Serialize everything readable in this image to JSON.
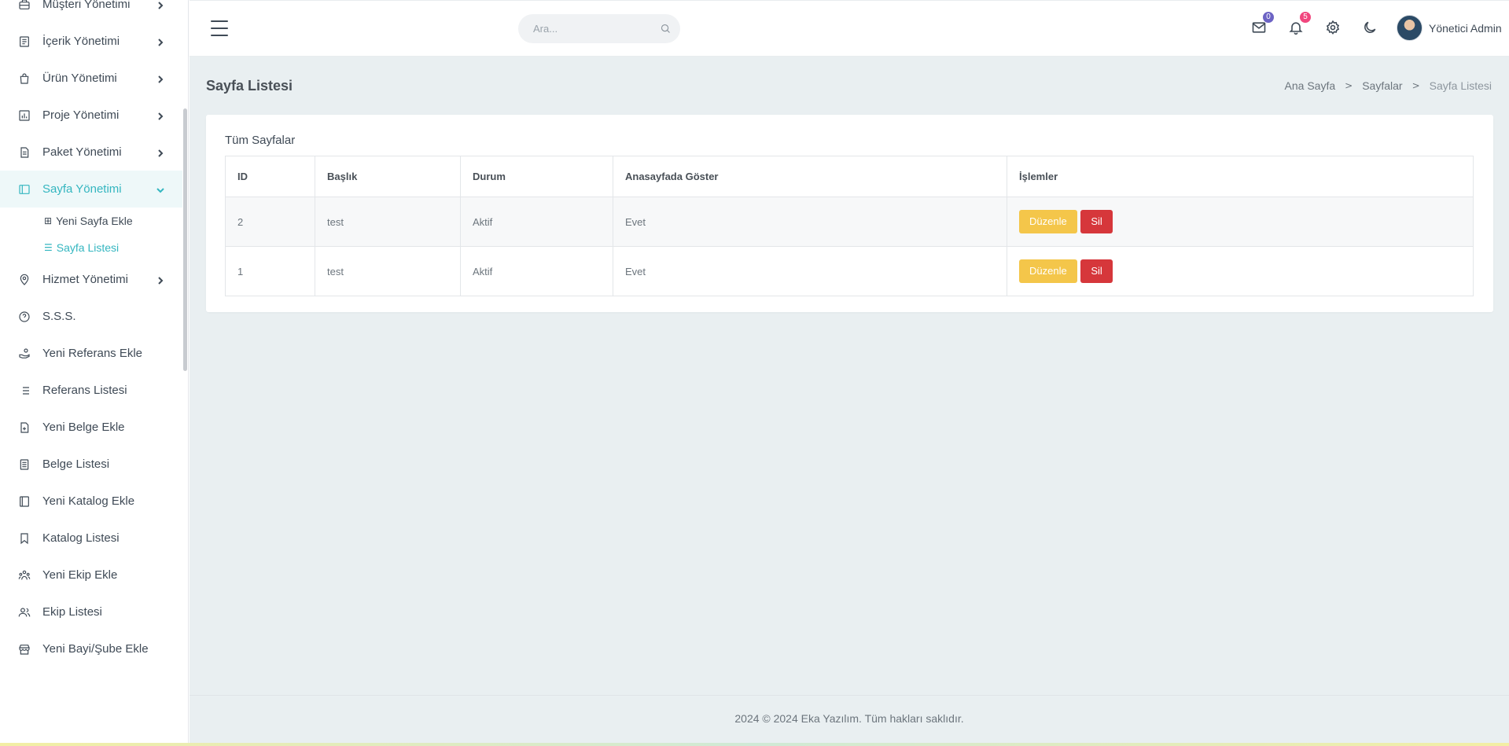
{
  "sidebar": {
    "items": [
      {
        "label": "Müşteri Yönetimi",
        "icon": "briefcase-icon",
        "has_children": true
      },
      {
        "label": "İçerik Yönetimi",
        "icon": "document-icon",
        "has_children": true
      },
      {
        "label": "Ürün Yönetimi",
        "icon": "shopping-bag-icon",
        "has_children": true
      },
      {
        "label": "Proje Yönetimi",
        "icon": "bar-chart-icon",
        "has_children": true
      },
      {
        "label": "Paket Yönetimi",
        "icon": "file-text-icon",
        "has_children": true
      },
      {
        "label": "Sayfa Yönetimi",
        "icon": "layout-icon",
        "has_children": true,
        "expanded": true
      },
      {
        "label": "Hizmet Yönetimi",
        "icon": "map-pin-icon",
        "has_children": true
      },
      {
        "label": "S.S.S.",
        "icon": "help-circle-icon"
      },
      {
        "label": "Yeni Referans Ekle",
        "icon": "hand-coins-icon"
      },
      {
        "label": "Referans Listesi",
        "icon": "list-icon"
      },
      {
        "label": "Yeni Belge Ekle",
        "icon": "file-plus-icon"
      },
      {
        "label": "Belge Listesi",
        "icon": "file-list-icon"
      },
      {
        "label": "Yeni Katalog Ekle",
        "icon": "book-open-icon"
      },
      {
        "label": "Katalog Listesi",
        "icon": "bookmark-icon"
      },
      {
        "label": "Yeni Ekip Ekle",
        "icon": "team-icon"
      },
      {
        "label": "Ekip Listesi",
        "icon": "users-icon"
      },
      {
        "label": "Yeni Bayi/Şube Ekle",
        "icon": "store-icon"
      }
    ],
    "sub_items": [
      {
        "label": "Yeni Sayfa Ekle",
        "icon_glyph": "⊞"
      },
      {
        "label": "Sayfa Listesi",
        "icon_glyph": "☰"
      }
    ]
  },
  "header": {
    "search_placeholder": "Ara...",
    "mail_badge": "0",
    "notification_badge": "5",
    "user_name": "Yönetici Admin"
  },
  "page": {
    "title": "Sayfa Listesi",
    "breadcrumb": [
      "Ana Sayfa",
      "Sayfalar",
      "Sayfa Listesi"
    ]
  },
  "card": {
    "title": "Tüm Sayfalar",
    "columns": [
      "ID",
      "Başlık",
      "Durum",
      "Anasayfada Göster",
      "İşlemler"
    ],
    "rows": [
      {
        "id": "2",
        "title": "test",
        "status": "Aktif",
        "show_home": "Evet"
      },
      {
        "id": "1",
        "title": "test",
        "status": "Aktif",
        "show_home": "Evet"
      }
    ],
    "edit_label": "Düzenle",
    "delete_label": "Sil"
  },
  "footer": {
    "text": "2024 © 2024 Eka Yazılım. Tüm hakları saklıdır."
  },
  "colors": {
    "accent": "#34b6c0",
    "edit_button": "#f4c64a",
    "delete_button": "#d6373b",
    "badge_mail": "#6c63c4",
    "badge_notification": "#f1467e",
    "content_bg": "#e9eff1"
  }
}
